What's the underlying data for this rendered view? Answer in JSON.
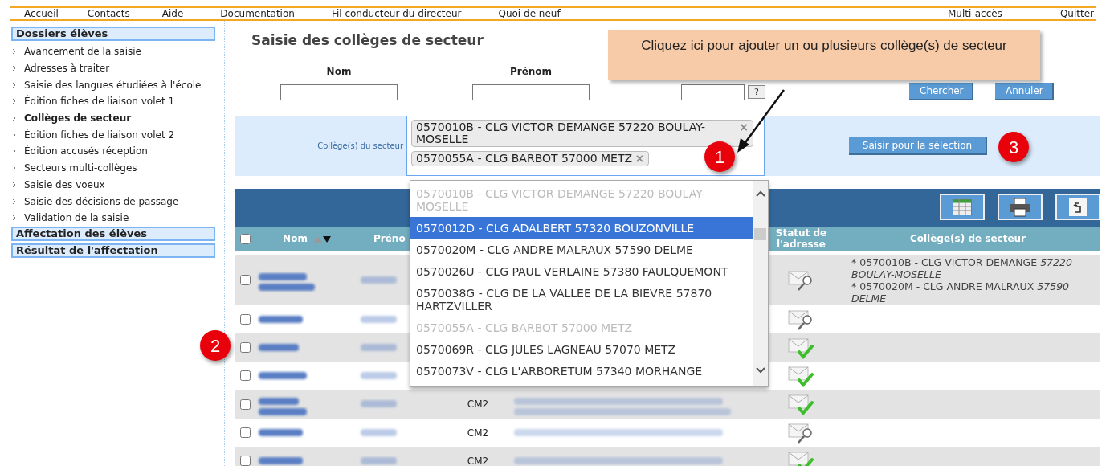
{
  "menu": {
    "left": [
      "Accueil",
      "Contacts",
      "Aide",
      "Documentation",
      "Fil conducteur du directeur",
      "Quoi de neuf"
    ],
    "right": [
      "Multi-accès",
      "Quitter"
    ]
  },
  "sidebar": {
    "sections": [
      {
        "title": "Dossiers élèves",
        "items": [
          {
            "label": "Avancement de la saisie",
            "selected": false
          },
          {
            "label": "Adresses à traiter",
            "selected": false
          },
          {
            "label": "Saisie des langues étudiées à l'école",
            "selected": false
          },
          {
            "label": "Édition fiches de liaison volet 1",
            "selected": false
          },
          {
            "label": "Collèges de secteur",
            "selected": true
          },
          {
            "label": "Édition fiches de liaison volet 2",
            "selected": false
          },
          {
            "label": "Édition accusés réception",
            "selected": false
          },
          {
            "label": "Secteurs multi-collèges",
            "selected": false
          },
          {
            "label": "Saisie des voeux",
            "selected": false
          },
          {
            "label": "Saisie des décisions de passage",
            "selected": false
          },
          {
            "label": "Validation de la saisie",
            "selected": false
          }
        ]
      },
      {
        "title": "Affectation des élèves"
      },
      {
        "title": "Résultat de l'affectation"
      }
    ]
  },
  "page_title": "Saisie des collèges de secteur",
  "search": {
    "fields": [
      {
        "label": "Nom"
      },
      {
        "label": "Prénom"
      }
    ],
    "help": "?",
    "buttons": [
      "Chercher",
      "Annuler"
    ]
  },
  "sector": {
    "label": "Collège(s) du secteur",
    "tags": [
      {
        "text": "0570010B - CLG VICTOR DEMANGE 57220 BOULAY-MOSELLE",
        "remove": "×"
      },
      {
        "text": "0570055A - CLG BARBOT 57000 METZ",
        "remove": "×"
      }
    ],
    "button": "Saisir pour la sélection",
    "options": [
      {
        "text": "0570010B - CLG VICTOR DEMANGE 57220 BOULAY-MOSELLE",
        "disabled": true,
        "selected": false
      },
      {
        "text": "0570012D - CLG ADALBERT 57320 BOUZONVILLE",
        "disabled": false,
        "selected": true
      },
      {
        "text": "0570020M - CLG ANDRE MALRAUX 57590 DELME",
        "disabled": false,
        "selected": false
      },
      {
        "text": "0570026U - CLG PAUL VERLAINE 57380 FAULQUEMONT",
        "disabled": false,
        "selected": false
      },
      {
        "text": "0570038G - CLG DE LA VALLEE DE LA BIEVRE 57870 HARTZVILLER",
        "disabled": false,
        "selected": false
      },
      {
        "text": "0570055A - CLG BARBOT 57000 METZ",
        "disabled": true,
        "selected": false
      },
      {
        "text": "0570069R - CLG JULES LAGNEAU 57070 METZ",
        "disabled": false,
        "selected": false
      },
      {
        "text": "0570073V - CLG L'ARBORETUM 57340 MORHANGE",
        "disabled": false,
        "selected": false
      }
    ]
  },
  "table": {
    "select_all": {
      "checked": false
    },
    "header": {
      "nom": "Nom",
      "prenom": "Préno",
      "statut": "Statut de l'adresse",
      "colleges": "Collège(s) de secteur"
    },
    "rows": [
      {
        "checked": false,
        "tall": true,
        "address_ok": false,
        "colleges": [
          {
            "name": "* 0570010B - CLG VICTOR DEMANGE",
            "place": "57220 BOULAY-MOSELLE"
          },
          {
            "name": "* 0570020M - CLG ANDRE MALRAUX",
            "place": "57590 DELME"
          }
        ]
      },
      {
        "checked": false,
        "tall": false,
        "address_ok": false,
        "colleges": []
      },
      {
        "checked": false,
        "tall": false,
        "address_ok": true,
        "colleges": []
      },
      {
        "checked": false,
        "tall": false,
        "address_ok": true,
        "colleges": []
      },
      {
        "checked": false,
        "tall": true,
        "class": "CM2",
        "address_ok": true,
        "colleges": []
      },
      {
        "checked": false,
        "tall": false,
        "class": "CM2",
        "address_ok": false,
        "colleges": []
      },
      {
        "checked": false,
        "tall": false,
        "class": "CM2",
        "address_ok": true,
        "colleges": []
      }
    ]
  },
  "annotations": {
    "callout": "Cliquez ici pour ajouter un ou plusieurs collège(s) de secteur",
    "badges": [
      "1",
      "2",
      "3"
    ]
  }
}
